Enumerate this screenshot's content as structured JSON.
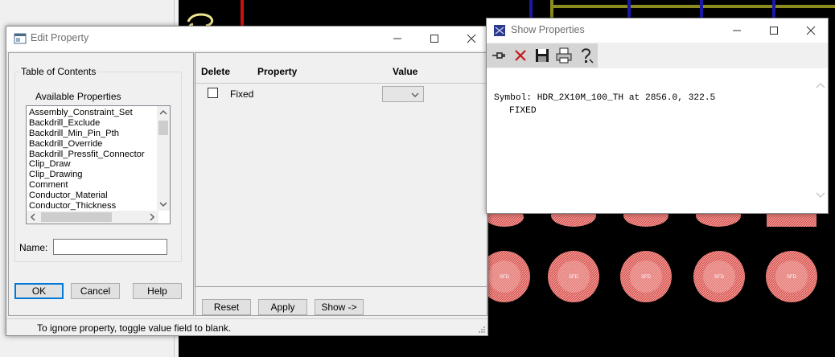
{
  "edit_property": {
    "title": "Edit Property",
    "toc_legend": "Table of Contents",
    "available_label": "Available Properties",
    "properties": [
      "Assembly_Constraint_Set",
      "Backdrill_Exclude",
      "Backdrill_Min_Pin_Pth",
      "Backdrill_Override",
      "Backdrill_Pressfit_Connector",
      "Clip_Draw",
      "Clip_Drawing",
      "Comment",
      "Conductor_Material",
      "Conductor_Thickness"
    ],
    "name_label": "Name:",
    "name_value": "",
    "ok_label": "OK",
    "cancel_label": "Cancel",
    "help_label": "Help",
    "col_delete": "Delete",
    "col_property": "Property",
    "col_value": "Value",
    "row": {
      "property": "Fixed",
      "checked": false,
      "value": ""
    },
    "reset_label": "Reset",
    "apply_label": "Apply",
    "show_label": "Show ->",
    "status_text": "To ignore property, toggle value field to blank."
  },
  "show_properties": {
    "title": "Show Properties",
    "toolbar": [
      "pin-icon",
      "close-x-icon",
      "save-icon",
      "print-icon",
      "help-icon"
    ],
    "line1": "Symbol: HDR_2X10M_100_TH at 2856.0, 322.5",
    "line2": "FIXED"
  },
  "canvas": {
    "pad_label": "SFD",
    "colors": {
      "background": "#000000",
      "pad": "#d9534f",
      "trace_blue": "#1a1aa8",
      "trace_olive": "#8b8b1e",
      "trace_red": "#cc1111",
      "glyph_yellow": "#f0e68c"
    }
  }
}
